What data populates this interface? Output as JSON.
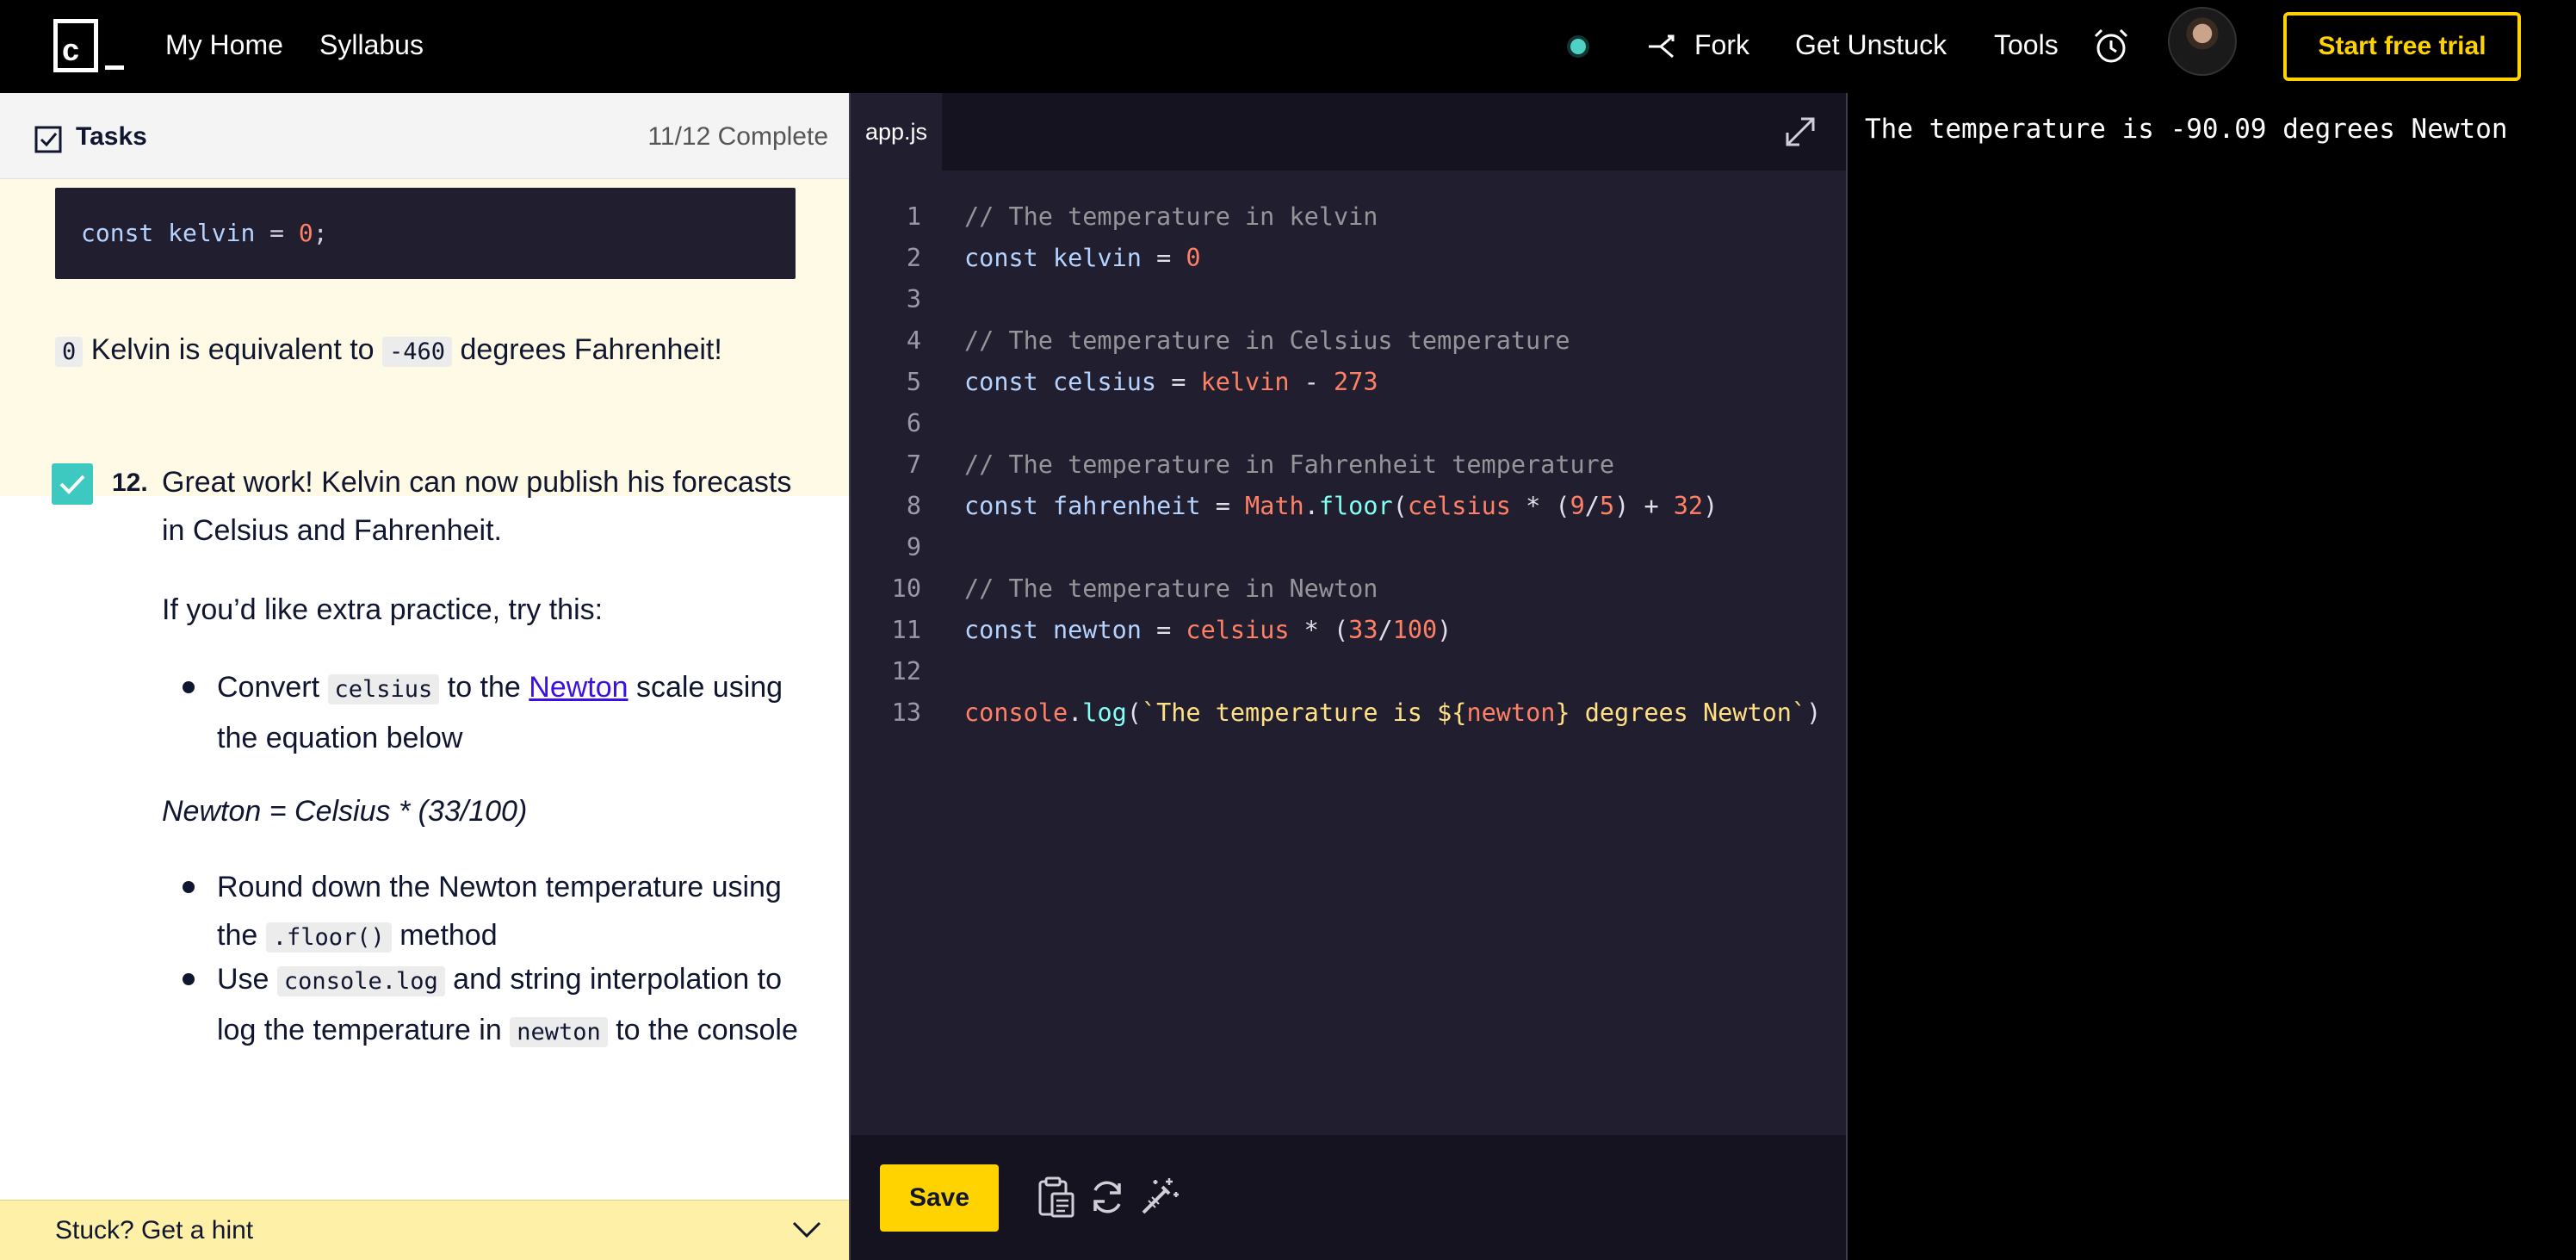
{
  "nav": {
    "home": "My Home",
    "syllabus": "Syllabus",
    "fork": "Fork",
    "unstuck": "Get Unstuck",
    "tools": "Tools",
    "trial": "Start free trial",
    "logo_letter": "c"
  },
  "tasks": {
    "title": "Tasks",
    "progress": "11/12 Complete"
  },
  "prev": {
    "code_kw": "const",
    "code_name": "kelvin",
    "code_eq": "=",
    "code_num": "0",
    "code_semi": ";",
    "v1": "0",
    "t1": " Kelvin is equivalent to ",
    "v2": "-460",
    "t2": " degrees Fahrenheit!"
  },
  "step": {
    "number": "12.",
    "intro": "Great work! Kelvin can now publish his forecasts in Celsius and Fahrenheit.",
    "practice": "If you’d like extra practice, try this:",
    "b1_a": "Convert ",
    "b1_code": "celsius",
    "b1_b": " to the ",
    "b1_link": "Newton",
    "b1_c": " scale using the equation below",
    "formula": "Newton = Celsius * (33/100)",
    "b2_a": "Round down the Newton temperature using the ",
    "b2_code": ".floor()",
    "b2_b": " method",
    "b3_a": "Use ",
    "b3_code": "console.log",
    "b3_b": " and string interpolation to log the temperature in ",
    "b3_code2": "newton",
    "b3_c": " to the console"
  },
  "hint": {
    "label": "Stuck? Get a hint"
  },
  "editor": {
    "tab": "app.js",
    "save": "Save",
    "line_numbers": [
      "1",
      "2",
      "3",
      "4",
      "5",
      "6",
      "7",
      "8",
      "9",
      "10",
      "11",
      "12",
      "13"
    ],
    "l1": "// The temperature in kelvin",
    "l4": "// The temperature in Celsius temperature",
    "l7": "// The temperature in Fahrenheit temperature",
    "l10": "// The temperature in Newton",
    "const": "const",
    "kelvin": "kelvin",
    "celsius": "celsius",
    "fahrenheit": "fahrenheit",
    "newton": "newton",
    "eq": " = ",
    "zero": "0",
    "minus": " - ",
    "n273": "273",
    "math": "Math",
    "floor": "floor",
    "mul": " * ",
    "n9": "9",
    "n5": "5",
    "plus": " + ",
    "n32": "32",
    "n33": "33",
    "n100": "100",
    "console": "console",
    "log": "log",
    "tpl_a": "`The temperature is ${",
    "tpl_b": "} degrees Newton`"
  },
  "output": {
    "text": "The temperature is -90.09 degrees Newton"
  },
  "colors": {
    "accent_yellow": "#ffd300",
    "check_teal": "#3ec9c0",
    "editor_bg": "#211e2f",
    "status_dot": "#4fd1c5"
  }
}
